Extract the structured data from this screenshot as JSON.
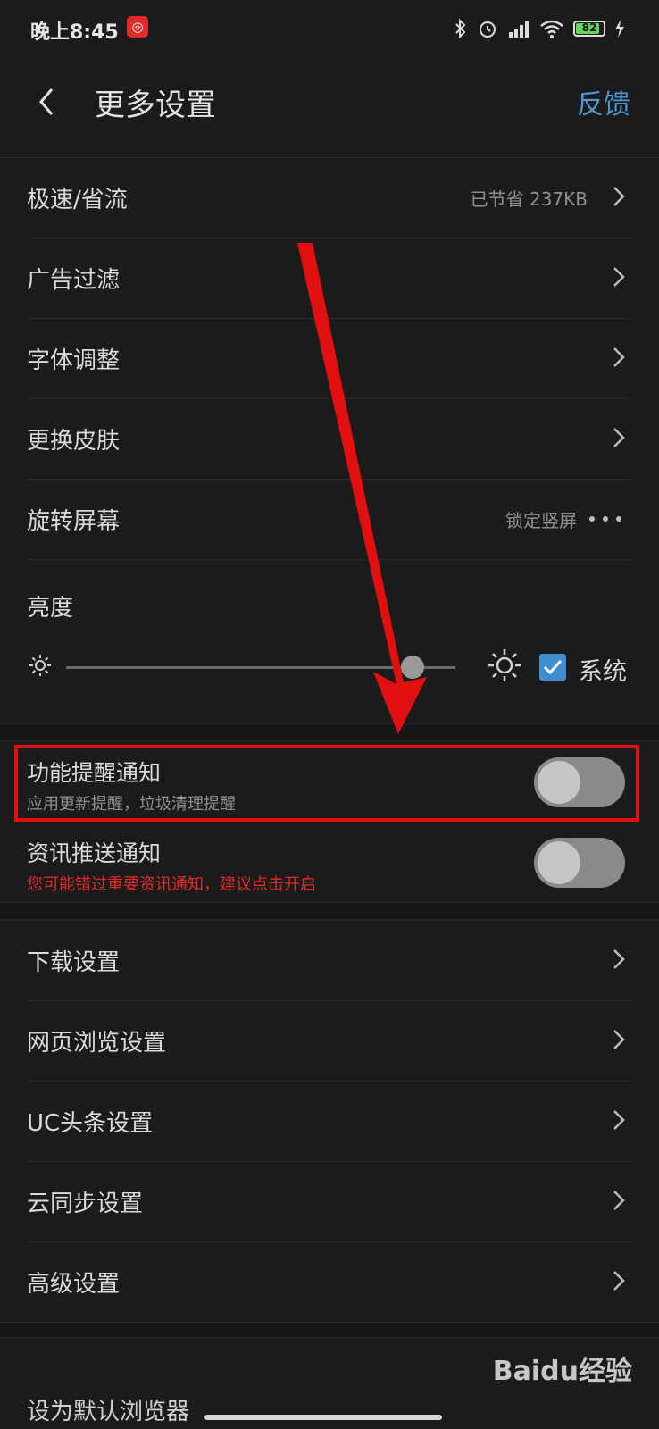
{
  "status": {
    "time": "晚上8:45",
    "app_icon": "netease-music-icon",
    "battery": "82"
  },
  "header": {
    "title": "更多设置",
    "feedback": "反馈"
  },
  "items_top": [
    {
      "label": "极速/省流",
      "value": "已节省 237KB"
    },
    {
      "label": "广告过滤",
      "value": ""
    },
    {
      "label": "字体调整",
      "value": ""
    },
    {
      "label": "更换皮肤",
      "value": ""
    },
    {
      "label": "旋转屏幕",
      "value": "锁定竖屏"
    }
  ],
  "brightness": {
    "label": "亮度",
    "system_label": "系统",
    "level": 0.89,
    "system_checked": true
  },
  "notifications": [
    {
      "label": "功能提醒通知",
      "sub": "应用更新提醒，垃圾清理提醒",
      "on": false
    },
    {
      "label": "资讯推送通知",
      "sub": "您可能错过重要资讯通知，建议点击开启",
      "on": false
    }
  ],
  "items_bottom": [
    {
      "label": "下载设置"
    },
    {
      "label": "网页浏览设置"
    },
    {
      "label": "UC头条设置"
    },
    {
      "label": "云同步设置"
    },
    {
      "label": "高级设置"
    }
  ],
  "partial_item": "设为默认浏览器",
  "watermark": "Baidu经验",
  "colors": {
    "accent": "#4d98d6",
    "highlight": "#e01010",
    "warning_text": "#e22a2a"
  }
}
